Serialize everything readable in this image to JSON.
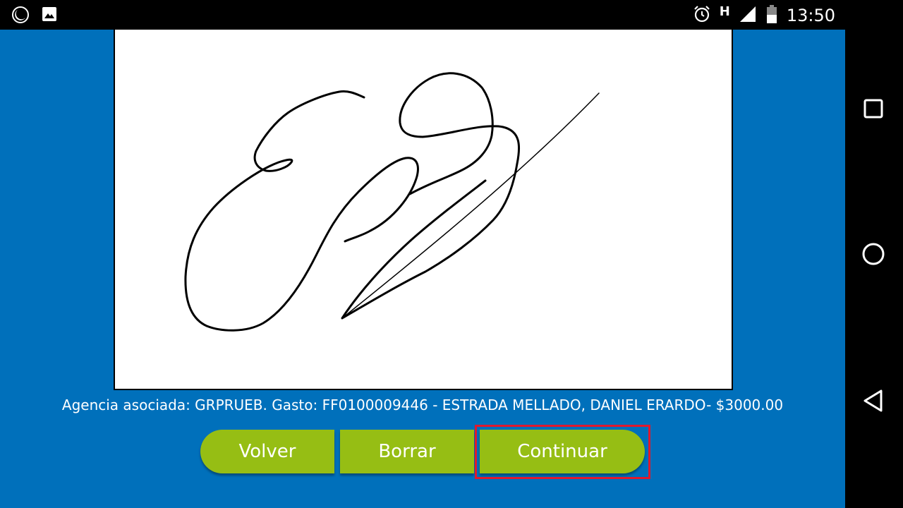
{
  "status_bar": {
    "network_type": "H",
    "time": "13:50",
    "icons": [
      "moon-icon",
      "image-icon",
      "alarm-icon",
      "signal-icon",
      "battery-icon"
    ]
  },
  "signature_pad": {
    "content": "handwritten-signature"
  },
  "caption": {
    "text": "Agencia asociada: GRPRUEB. Gasto: FF0100009446 - ESTRADA MELLADO, DANIEL ERARDO- $3000.00"
  },
  "buttons": {
    "volver": "Volver",
    "borrar": "Borrar",
    "continuar": "Continuar"
  },
  "nav_bar": {
    "icons": [
      "recents-icon",
      "home-icon",
      "back-icon"
    ]
  },
  "colors": {
    "background": "#0070bb",
    "button": "#96be14",
    "highlight": "#e0192d"
  }
}
